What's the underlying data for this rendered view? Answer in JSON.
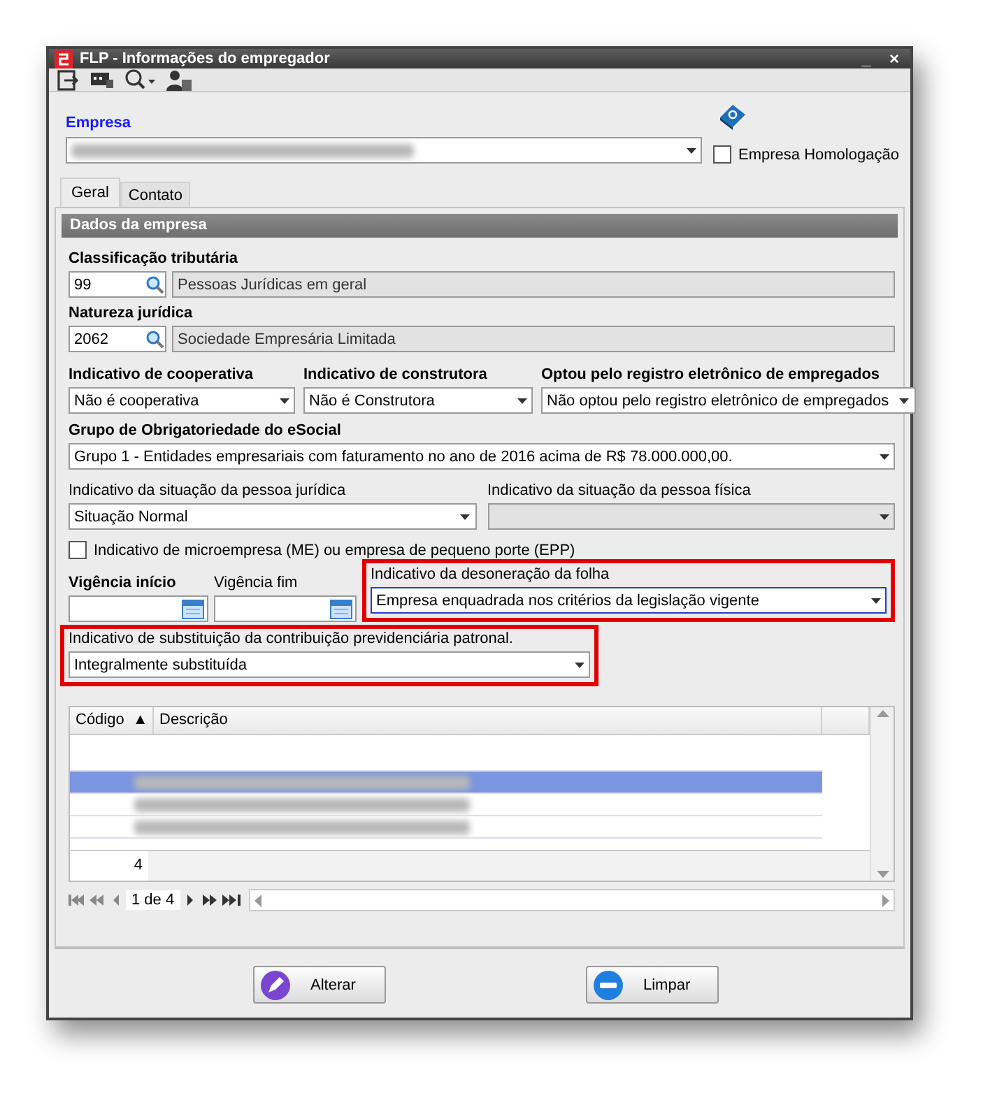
{
  "window": {
    "title": "FLP - Informações do empregador",
    "controls": [
      {
        "label": "_"
      },
      {
        "label": "×"
      }
    ]
  },
  "empresa": {
    "label": "Empresa",
    "redacted": true,
    "homologacao": {
      "label": "Empresa Homologação",
      "checked": false
    }
  },
  "tabs": [
    {
      "label": "Geral",
      "selected": true
    },
    {
      "label": "Contato",
      "selected": false
    }
  ],
  "section_title": "Dados da empresa",
  "lookups": [
    {
      "label": "Classificação tributária",
      "code": "99",
      "description": "Pessoas Jurídicas em geral"
    },
    {
      "label": "Natureza jurídica",
      "code": "2062",
      "description": "Sociedade Empresária Limitada"
    }
  ],
  "indicativos": [
    {
      "label": "Indicativo de cooperativa",
      "value": "Não é cooperativa"
    },
    {
      "label": "Indicativo de construtora",
      "value": "Não é Construtora"
    },
    {
      "label": "Optou pelo registro eletrônico de empregados",
      "value": "Não optou pelo registro eletrônico de empregados"
    }
  ],
  "grupo": {
    "label": "Grupo de Obrigatoriedade do eSocial",
    "value": "Grupo 1 - Entidades empresariais com faturamento no ano de 2016 acima de R$ 78.000.000,00."
  },
  "situacao": [
    {
      "label": "Indicativo da situação da pessoa jurídica",
      "value": "Situação Normal",
      "disabled": false
    },
    {
      "label": "Indicativo da situação da pessoa física",
      "disabled": true
    }
  ],
  "microempresa": {
    "label": "Indicativo de microempresa (ME) ou empresa de pequeno porte (EPP)",
    "checked": false
  },
  "vigencia": [
    {
      "label": "Vigência início",
      "bold": true
    },
    {
      "label": "Vigência fim",
      "bold": false
    }
  ],
  "desoneracao": {
    "label": "Indicativo da desoneração da folha",
    "value": "Empresa enquadrada nos critérios da legislação vigente",
    "highlighted": true,
    "focused": true
  },
  "substituicao": {
    "label": "Indicativo de substituição da contribuição previdenciária patronal.",
    "value": "Integralmente substituída",
    "highlighted": true,
    "focused": false
  },
  "grid": {
    "columns": [
      {
        "label": "Código",
        "sort": "▲"
      },
      {
        "label": "Descrição"
      }
    ],
    "rows": [
      {
        "selected": false,
        "redacted": false
      },
      {
        "selected": true,
        "redacted": true
      },
      {
        "selected": false,
        "redacted": true
      },
      {
        "selected": false,
        "redacted": true
      }
    ],
    "count": "4",
    "pager": "1 de 4"
  },
  "buttons": [
    {
      "label": "Alterar",
      "kind": "edit"
    },
    {
      "label": "Limpar",
      "kind": "clear"
    }
  ]
}
